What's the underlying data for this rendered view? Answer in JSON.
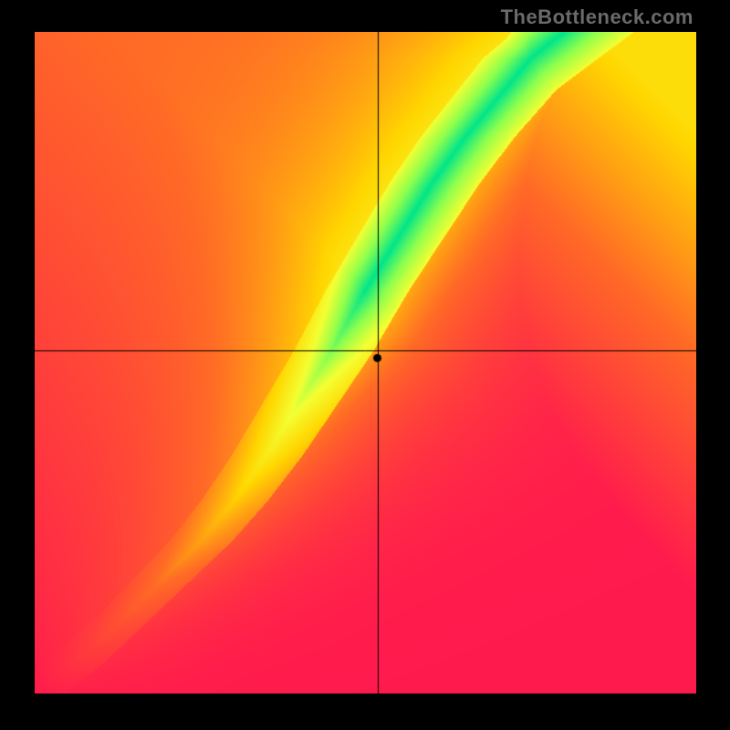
{
  "watermark": "TheBottleneck.com",
  "chart_data": {
    "type": "heatmap",
    "title": "",
    "xlabel": "",
    "ylabel": "",
    "xlim": [
      0,
      1
    ],
    "ylim": [
      0,
      1
    ],
    "x_crosshair": 0.518,
    "y_crosshair": 0.518,
    "point": {
      "x": 0.518,
      "y": 0.507
    },
    "ridge_curve": {
      "description": "Optimal (green) ridge; points are (x, y) in normalized chart space, y from bottom",
      "points": [
        [
          0.0,
          0.0
        ],
        [
          0.05,
          0.04
        ],
        [
          0.1,
          0.08
        ],
        [
          0.15,
          0.13
        ],
        [
          0.2,
          0.18
        ],
        [
          0.25,
          0.23
        ],
        [
          0.3,
          0.29
        ],
        [
          0.35,
          0.36
        ],
        [
          0.4,
          0.44
        ],
        [
          0.45,
          0.52
        ],
        [
          0.5,
          0.61
        ],
        [
          0.55,
          0.69
        ],
        [
          0.6,
          0.77
        ],
        [
          0.65,
          0.84
        ],
        [
          0.7,
          0.9
        ],
        [
          0.75,
          0.96
        ],
        [
          0.8,
          1.0
        ]
      ]
    },
    "color_scale": {
      "0.00": "#ff1a4d",
      "0.30": "#ff6a26",
      "0.55": "#ffd600",
      "0.72": "#f4ff33",
      "0.85": "#8fff4d",
      "1.00": "#00e58a"
    },
    "falloff_sharpness": 5.5,
    "resolution": 256
  }
}
